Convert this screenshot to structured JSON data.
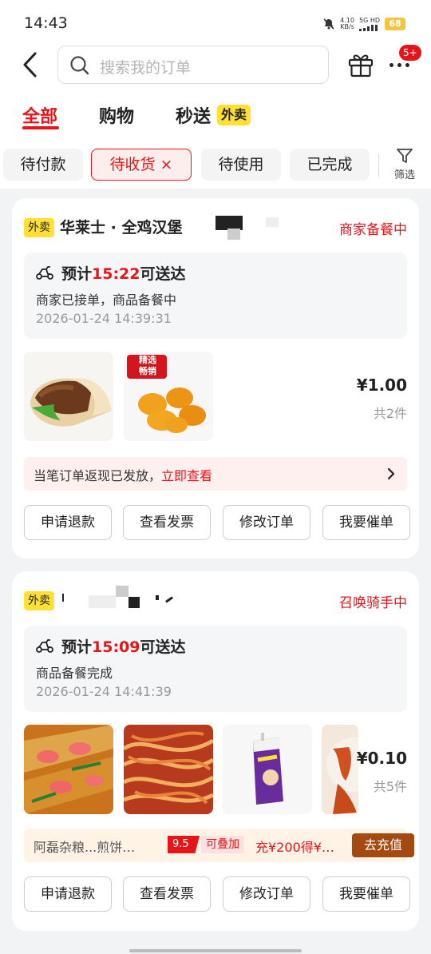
{
  "status_bar": {
    "time": "14:43",
    "net_speed": "4.10",
    "net_unit": "KB/s",
    "signal_label": "5G HD",
    "battery": "68"
  },
  "header": {
    "search_placeholder": "搜索我的订单",
    "more_badge": "5+"
  },
  "tabs": [
    {
      "label": "全部",
      "active": true
    },
    {
      "label": "购物",
      "active": false
    },
    {
      "label": "秒送",
      "tag": "外卖",
      "active": false
    }
  ],
  "filters": {
    "chips": [
      "待付款",
      "待收货 ×",
      "待使用",
      "已完成"
    ],
    "active_index": 1,
    "filter_label": "筛选"
  },
  "orders": [
    {
      "tag": "外卖",
      "shop": "华莱士 · 全鸡汉堡",
      "status": "商家备餐中",
      "eta_prefix": "预计",
      "eta_time": "15:22",
      "eta_suffix": "可送达",
      "sub": "商家已接单，商品备餐中",
      "time": "2026-01-24 14:39:31",
      "badge_text": "精选\n畅销",
      "price": "¥1.00",
      "count": "共2件",
      "banner_text": "当笔订单返现已发放，",
      "banner_link": "立即查看",
      "buttons": [
        "申请退款",
        "查看发票",
        "修改订单",
        "我要催单"
      ]
    },
    {
      "tag": "外卖",
      "shop": "",
      "status": "召唤骑手中",
      "eta_prefix": "预计",
      "eta_time": "15:09",
      "eta_suffix": "可送达",
      "sub": "商品备餐完成",
      "time": "2026-01-24 14:41:39",
      "price": "¥0.10",
      "count": "共5件",
      "promo_shop": "阿磊杂粮...煎饼…",
      "promo_discount": "9.5",
      "promo_stack": "可叠加",
      "promo_recharge": "充¥200得¥…",
      "promo_button": "去充值",
      "buttons": [
        "申请退款",
        "查看发票",
        "修改订单",
        "我要催单"
      ]
    }
  ],
  "colors": {
    "accent": "#e7141a",
    "tag_yellow": "#ffe033",
    "recharge_brown": "#a44a10"
  }
}
